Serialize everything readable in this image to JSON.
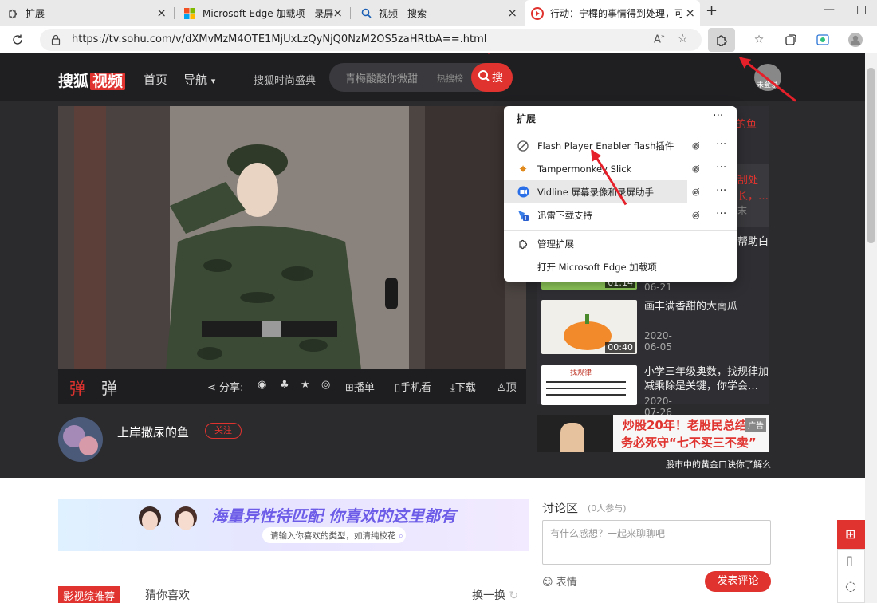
{
  "tabs": [
    {
      "title": "扩展",
      "icon": "puzzle"
    },
    {
      "title": "Microsoft Edge 加载项 - 录屏",
      "icon": "windows"
    },
    {
      "title": "视频 - 搜索",
      "icon": "search"
    },
    {
      "title": "行动：宁樨的事情得到处理，可以",
      "icon": "play"
    }
  ],
  "new_tab": "+",
  "window": {
    "minimize": "—",
    "maximize": "□"
  },
  "address": {
    "url": "https://tv.sohu.com/v/dXMvMzM4OTE1MjUxLzQyNjQ0NzM2OS5zaHRtbA==.html",
    "reader": "A",
    "reader_sup": "»"
  },
  "header": {
    "logo_text": "搜狐",
    "logo_badge": "视频",
    "nav_home": "首页",
    "nav_guide": "导航",
    "fashion": "搜狐时尚盛典",
    "search_placeholder": "青梅酸酸你微甜",
    "hot_label": "热搜榜",
    "search_btn": "搜",
    "avatar_label": "未登录"
  },
  "controls": {
    "danmu_on": "弹",
    "danmu_settings": "弹",
    "share": "分享:",
    "playlist": "播单",
    "mobile": "手机看",
    "download": "下载",
    "like": "顶"
  },
  "uploader": {
    "name": "上岸撒尿的鱼",
    "follow": "关注"
  },
  "side_partial": {
    "t1": "的鱼",
    "t2": "刮处",
    "t3": "长，…",
    "t4": "末"
  },
  "side_items": [
    {
      "title": "益智玩具，大家都来帮助白雪",
      "date": "2020-06-21",
      "duration": "01:14"
    },
    {
      "title": "画丰满香甜的大南瓜",
      "date": "2020-06-05",
      "duration": "00:40"
    },
    {
      "title": "小学三年级奥数，找规律加减乘除是关键，你学会…",
      "date": "2020-07-26",
      "duration": ""
    }
  ],
  "worksheet": {
    "heading": "找规律"
  },
  "ad": {
    "line1": "炒股20年！老股民总结",
    "line2": "务必死守“七不买三不卖”",
    "tag": "广告",
    "caption": "股市中的黄金口诀你了解么"
  },
  "banner": {
    "headline": "海量异性待匹配 你喜欢的这里都有",
    "sub": "请输入你喜欢的类型，如清纯校花"
  },
  "discussion": {
    "title": "讨论区",
    "count": "(0人参与)",
    "placeholder": "有什么感想？一起来聊聊吧",
    "emoji": "表情",
    "submit": "发表评论"
  },
  "recommend": {
    "tab_active": "影视综推荐",
    "tab_other": "猜你喜欢",
    "refresh": "换一换"
  },
  "extensions_popup": {
    "title": "扩展",
    "more": "···",
    "items": [
      {
        "name": "Flash Player Enabler flash插件",
        "icon": "flash"
      },
      {
        "name": "Tampermonkey Slick",
        "icon": "tampermonkey"
      },
      {
        "name": "Vidline 屏幕录像和录屏助手",
        "icon": "vidline"
      },
      {
        "name": "迅雷下载支持",
        "icon": "thunder"
      }
    ],
    "manage": "管理扩展",
    "open_addons": "打开 Microsoft Edge 加载项"
  },
  "colors": {
    "accent_red": "#e0332f",
    "arrow_red": "#e5202a",
    "dark_bg": "#2b2b2e"
  }
}
